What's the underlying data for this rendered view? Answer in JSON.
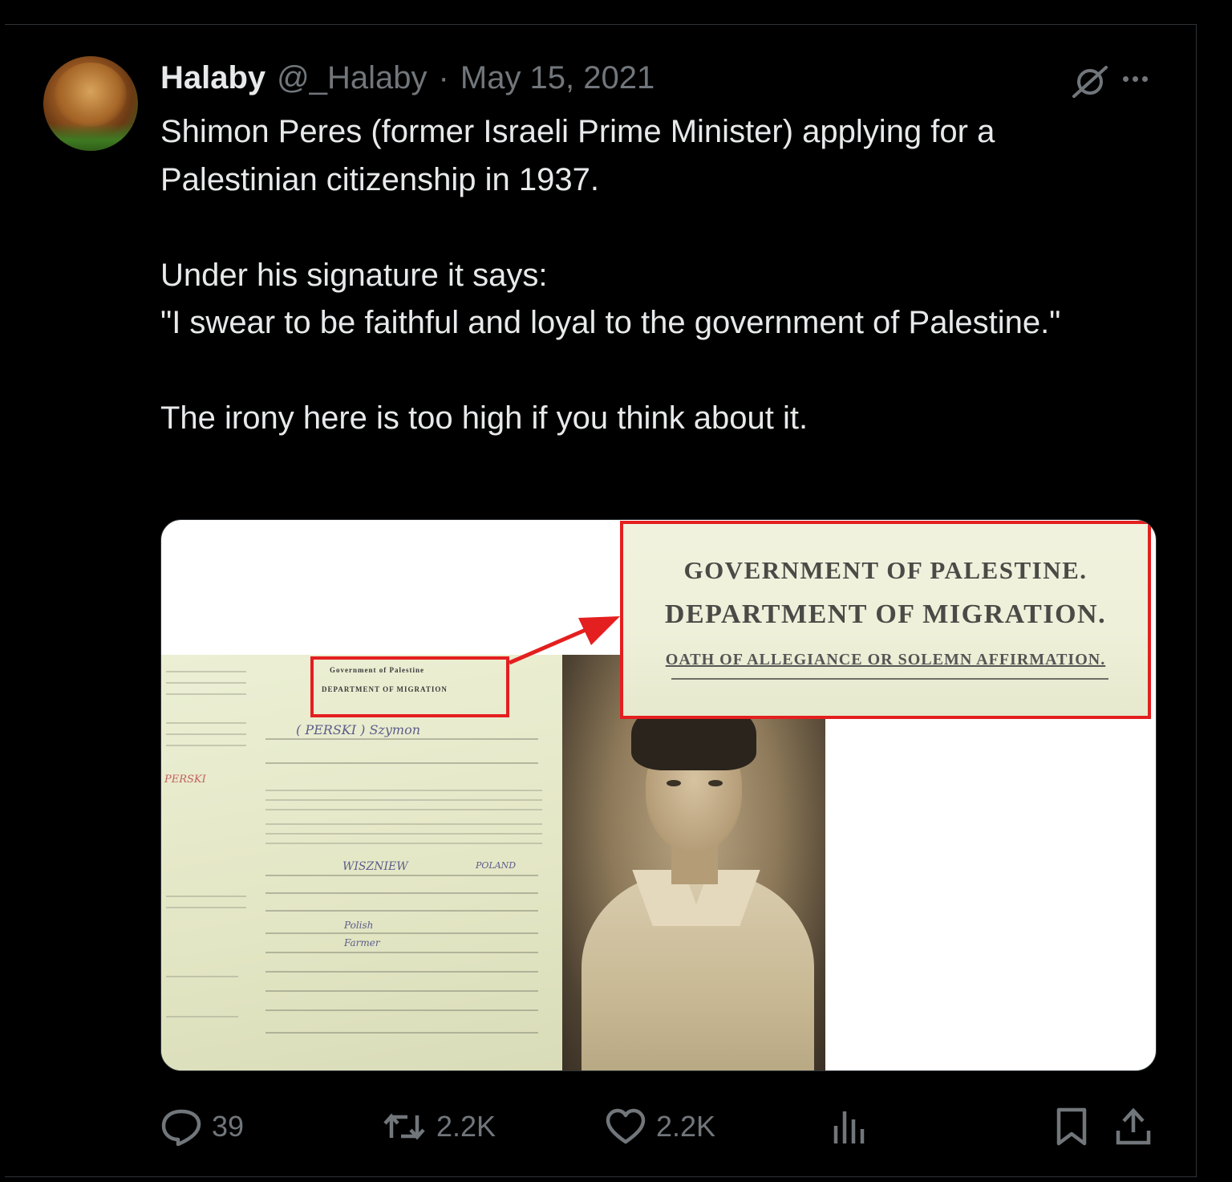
{
  "tweet": {
    "author_name": "Halaby",
    "handle": "@_Halaby",
    "separator": "·",
    "date": "May 15, 2021",
    "paragraphs": [
      "Shimon Peres (former Israeli Prime Minister) applying for a Palestinian citizenship in 1937.",
      "Under his signature it says:\n\"I swear to be faithful and loyal to the government of Palestine.\"",
      "The irony here is too high if you think about it."
    ]
  },
  "media": {
    "zoom_line1": "GOVERNMENT OF PALESTINE.",
    "zoom_line2": "DEPARTMENT OF MIGRATION.",
    "zoom_line3": "OATH OF ALLEGIANCE OR SOLEMN AFFIRMATION.",
    "doc_header1": "Government of Palestine",
    "doc_header2": "DEPARTMENT OF MIGRATION",
    "doc_name": "( PERSKI ) Szymon",
    "doc_red": "PERSKI",
    "doc_place": "WISZNIEW",
    "doc_country": "POLAND",
    "doc_nationality": "Polish",
    "doc_occupation": "Farmer",
    "accent_color": "#e41f1f"
  },
  "actions": {
    "reply_count": "39",
    "retweet_count": "2.2K",
    "like_count": "2.2K",
    "icons": [
      "reply-icon",
      "retweet-icon",
      "like-icon",
      "views-icon",
      "bookmark-icon",
      "share-icon"
    ]
  },
  "colors": {
    "background": "#000000",
    "text": "#e7e9ea",
    "muted": "#71767b",
    "border": "#2f3336"
  }
}
